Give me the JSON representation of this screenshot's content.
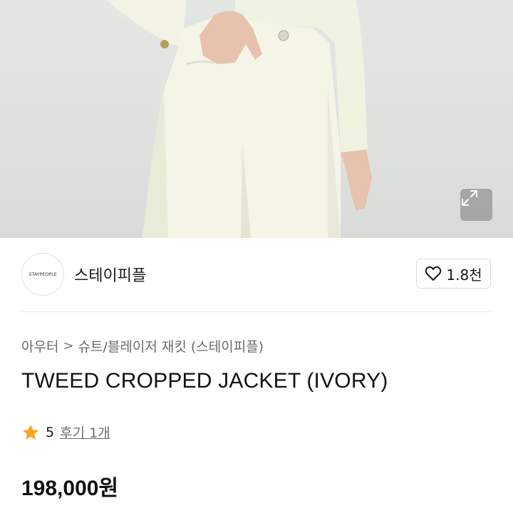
{
  "brand": {
    "logo_text": "STAYPEOPLE",
    "name": "스테이피플"
  },
  "like": {
    "count": "1.8천"
  },
  "breadcrumb": {
    "category": "아우터",
    "separator": ">",
    "subcategory": "슈트/블레이저 재킷 (스테이피플)"
  },
  "product": {
    "title": "TWEED CROPPED JACKET (IVORY)",
    "rating": "5",
    "reviews": "후기 1개",
    "price": "198,000원"
  },
  "colors": {
    "star": "#f5a623",
    "text": "#1a1a1a",
    "muted": "#6b6b6b",
    "background": "#ffffff"
  },
  "icons": {
    "expand": "expand-icon",
    "heart": "heart-icon",
    "star": "star-icon"
  }
}
